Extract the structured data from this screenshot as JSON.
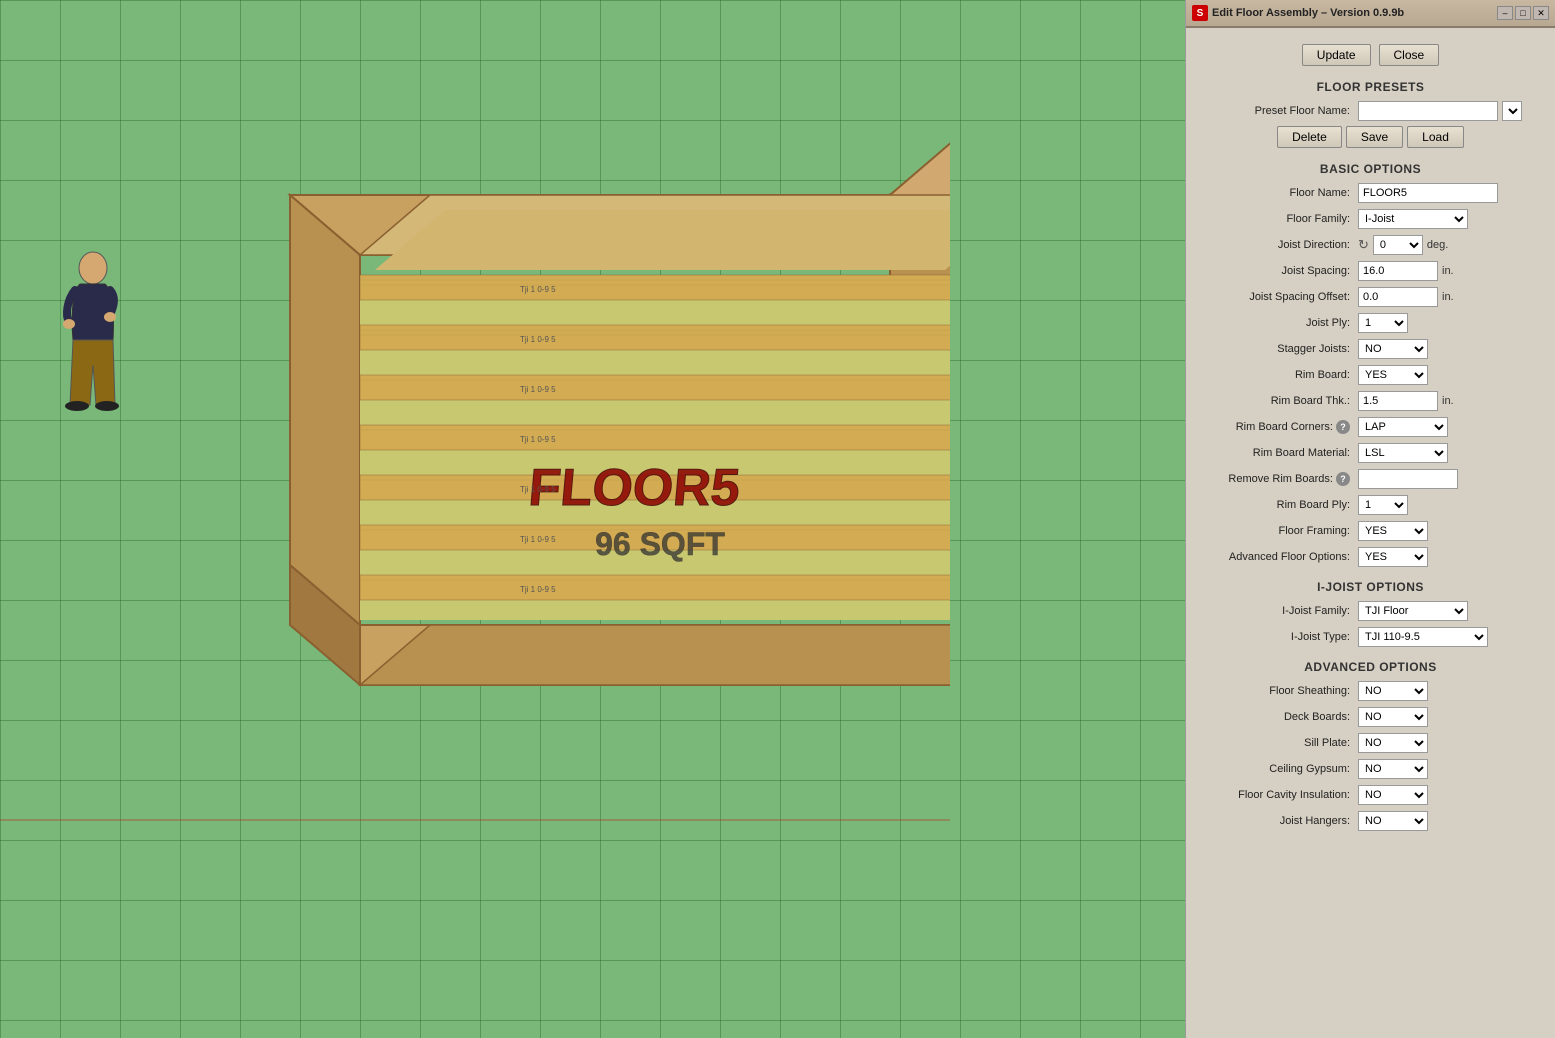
{
  "title_bar": {
    "icon": "⬛",
    "title": "Edit Floor Assembly – Version 0.9.9b",
    "minimize": "–",
    "maximize": "□",
    "close": "✕"
  },
  "top_buttons": {
    "update": "Update",
    "close": "Close"
  },
  "floor_presets": {
    "header": "FLOOR PRESETS",
    "preset_floor_name_label": "Preset Floor Name:",
    "preset_floor_name_value": "",
    "delete_label": "Delete",
    "save_label": "Save",
    "load_label": "Load"
  },
  "basic_options": {
    "header": "BASIC OPTIONS",
    "floor_name_label": "Floor Name:",
    "floor_name_value": "FLOOR5",
    "floor_family_label": "Floor Family:",
    "floor_family_value": "I-Joist",
    "joist_direction_label": "Joist Direction:",
    "joist_direction_value": "0",
    "joist_direction_unit": "deg.",
    "joist_spacing_label": "Joist Spacing:",
    "joist_spacing_value": "16.0",
    "joist_spacing_unit": "in.",
    "joist_spacing_offset_label": "Joist Spacing Offset:",
    "joist_spacing_offset_value": "0.0",
    "joist_spacing_offset_unit": "in.",
    "joist_ply_label": "Joist Ply:",
    "joist_ply_value": "1",
    "stagger_joists_label": "Stagger Joists:",
    "stagger_joists_value": "NO",
    "rim_board_label": "Rim Board:",
    "rim_board_value": "YES",
    "rim_board_thk_label": "Rim Board Thk.:",
    "rim_board_thk_value": "1.5",
    "rim_board_thk_unit": "in.",
    "rim_board_corners_label": "Rim Board Corners:",
    "rim_board_corners_value": "LAP",
    "rim_board_material_label": "Rim Board Material:",
    "rim_board_material_value": "LSL",
    "remove_rim_boards_label": "Remove Rim Boards:",
    "remove_rim_boards_value": "",
    "rim_board_ply_label": "Rim Board Ply:",
    "rim_board_ply_value": "1",
    "floor_framing_label": "Floor Framing:",
    "floor_framing_value": "YES",
    "advanced_floor_options_label": "Advanced Floor Options:",
    "advanced_floor_options_value": "YES"
  },
  "ijoist_options": {
    "header": "I-JOIST OPTIONS",
    "ijoist_family_label": "I-Joist Family:",
    "ijoist_family_value": "TJI Floor",
    "ijoist_type_label": "I-Joist Type:",
    "ijoist_type_value": "TJI 110-9.5"
  },
  "advanced_options": {
    "header": "ADVANCED OPTIONS",
    "floor_sheathing_label": "Floor Sheathing:",
    "floor_sheathing_value": "NO",
    "deck_boards_label": "Deck Boards:",
    "deck_boards_value": "NO",
    "sill_plate_label": "Sill Plate:",
    "sill_plate_value": "NO",
    "ceiling_gypsum_label": "Ceiling Gypsum:",
    "ceiling_gypsum_value": "NO",
    "floor_cavity_insulation_label": "Floor Cavity Insulation:",
    "floor_cavity_insulation_value": "NO",
    "joist_hangers_label": "Joist Hangers:",
    "joist_hangers_value": "NO"
  },
  "floor_label": "FLOOR5",
  "floor_sqft": "96 SQFT"
}
